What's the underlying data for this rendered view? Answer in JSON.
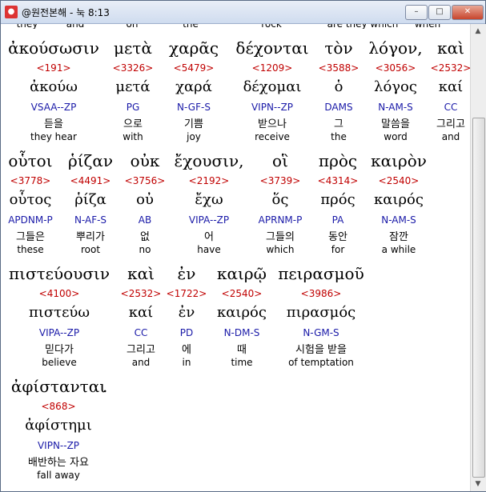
{
  "window": {
    "title": "@원전본해 - 눅 8:13",
    "icon": "app-icon",
    "buttons": {
      "minimize": "–",
      "maximize": "□",
      "close": "✕"
    }
  },
  "cutoff_text": [
    "they",
    "and",
    "on",
    "the",
    "rock",
    "are they which",
    "when"
  ],
  "rows": [
    {
      "words": [
        {
          "greek": "ἀκούσωσιν",
          "strong": "<191>",
          "lemma": "ἀκούω",
          "parsing": "VSAA--ZP",
          "korean": "듣을",
          "english": "they hear"
        },
        {
          "greek": "μετὰ",
          "strong": "<3326>",
          "lemma": "μετά",
          "parsing": "PG",
          "korean": "으로",
          "english": "with"
        },
        {
          "greek": "χαρᾶς",
          "strong": "<5479>",
          "lemma": "χαρά",
          "parsing": "N-GF-S",
          "korean": "기쁨",
          "english": "joy"
        },
        {
          "greek": "δέχονται",
          "strong": "<1209>",
          "lemma": "δέχομαι",
          "parsing": "VIPN--ZP",
          "korean": "받으나",
          "english": "receive"
        },
        {
          "greek": "τὸν",
          "strong": "<3588>",
          "lemma": "ὁ",
          "parsing": "DAMS",
          "korean": "그",
          "english": "the"
        },
        {
          "greek": "λόγον,",
          "strong": "<3056>",
          "lemma": "λόγος",
          "parsing": "N-AM-S",
          "korean": "말씀을",
          "english": "word"
        },
        {
          "greek": "καὶ",
          "strong": "<2532>",
          "lemma": "καί",
          "parsing": "CC",
          "korean": "그리고",
          "english": "and"
        }
      ]
    },
    {
      "words": [
        {
          "greek": "οὗτοι",
          "strong": "<3778>",
          "lemma": "οὗτος",
          "parsing": "APDNM-P",
          "korean": "그들은",
          "english": "these"
        },
        {
          "greek": "ῥίζαν",
          "strong": "<4491>",
          "lemma": "ῥίζα",
          "parsing": "N-AF-S",
          "korean": "뿌리가",
          "english": "root"
        },
        {
          "greek": "οὐκ",
          "strong": "<3756>",
          "lemma": "οὐ",
          "parsing": "AB",
          "korean": "없",
          "english": "no"
        },
        {
          "greek": "ἔχουσιν,",
          "strong": "<2192>",
          "lemma": "ἔχω",
          "parsing": "VIPA--ZP",
          "korean": "어",
          "english": "have"
        },
        {
          "greek": "οἳ",
          "strong": "<3739>",
          "lemma": "ὅς",
          "parsing": "APRNM-P",
          "korean": "그들의",
          "english": "which"
        },
        {
          "greek": "πρὸς",
          "strong": "<4314>",
          "lemma": "πρός",
          "parsing": "PA",
          "korean": "동안",
          "english": "for"
        },
        {
          "greek": "καιρὸν",
          "strong": "<2540>",
          "lemma": "καιρός",
          "parsing": "N-AM-S",
          "korean": "잠깐",
          "english": "a while"
        }
      ]
    },
    {
      "words": [
        {
          "greek": "πιστεύουσιν",
          "strong": "<4100>",
          "lemma": "πιστεύω",
          "parsing": "VIPA--ZP",
          "korean": "믿다가",
          "english": "believe"
        },
        {
          "greek": "καὶ",
          "strong": "<2532>",
          "lemma": "καί",
          "parsing": "CC",
          "korean": "그리고",
          "english": "and"
        },
        {
          "greek": "ἐν",
          "strong": "<1722>",
          "lemma": "ἐν",
          "parsing": "PD",
          "korean": "에",
          "english": "in"
        },
        {
          "greek": "καιρῷ",
          "strong": "<2540>",
          "lemma": "καιρός",
          "parsing": "N-DM-S",
          "korean": "때",
          "english": "time"
        },
        {
          "greek": "πειρασμοῦ",
          "strong": "<3986>",
          "lemma": "πιρασμός",
          "parsing": "N-GM-S",
          "korean": "시험을 받을",
          "english": "of temptation"
        }
      ]
    },
    {
      "words": [
        {
          "greek": "ἀφίστανται",
          "strong": "<868>",
          "lemma": "ἀφίστημι",
          "parsing": "VIPN--ZP",
          "korean": "배반하는 자요",
          "english": "fall away"
        }
      ],
      "trailing": "."
    }
  ]
}
